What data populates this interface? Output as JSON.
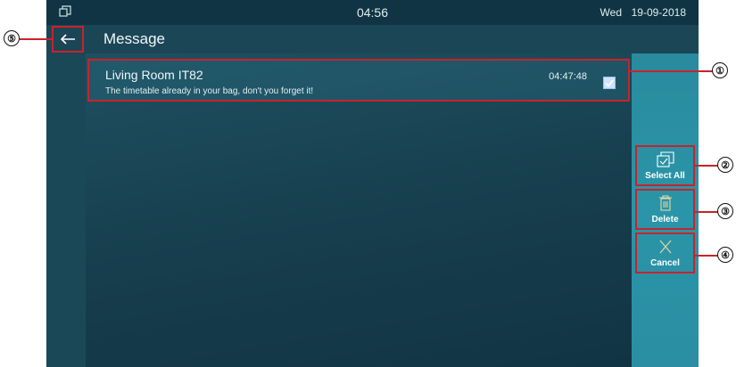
{
  "statusbar": {
    "time": "04:56",
    "day": "Wed",
    "date": "19-09-2018"
  },
  "header": {
    "back_icon": "arrow-left-icon",
    "title": "Message"
  },
  "messages": [
    {
      "sender": "Living Room IT82",
      "text": "The timetable already in your bag, don't you forget it!",
      "time": "04:47:48",
      "checked": true
    }
  ],
  "actions": {
    "select_all": "Select All",
    "delete": "Delete",
    "cancel": "Cancel"
  },
  "callouts": [
    "①",
    "②",
    "③",
    "④",
    "⑤"
  ],
  "colors": {
    "highlight": "#c8232b",
    "panel": "#17404f",
    "action_panel": "#2a8a9e"
  }
}
